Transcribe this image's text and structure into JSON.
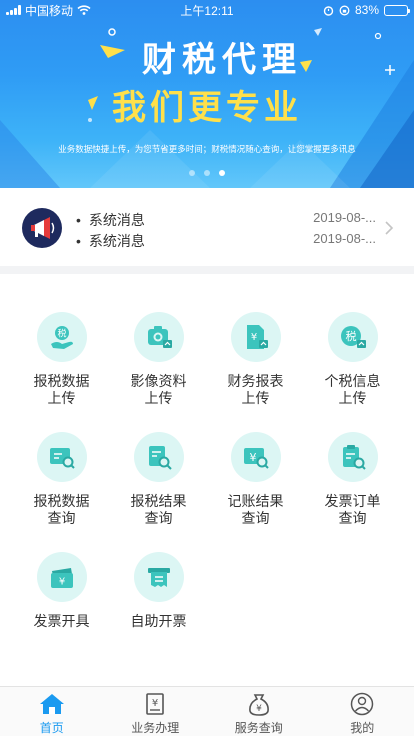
{
  "status_bar": {
    "carrier": "中国移动",
    "time": "上午12:11",
    "battery": "83%",
    "battery_level": 0.83
  },
  "banner": {
    "title_line1": "财税代理",
    "title_line2": "我们更专业",
    "subtitle": "业务数据快捷上传，为您节省更多时间；财税情况随心查询，让您掌握更多讯息",
    "page_count": 3,
    "active_page": 3
  },
  "notice": {
    "items": [
      {
        "text": "系统消息",
        "date": "2019-08-..."
      },
      {
        "text": "系统消息",
        "date": "2019-08-..."
      }
    ]
  },
  "services": [
    {
      "label": "报税数据\n上传",
      "icon": "tax-upload-icon"
    },
    {
      "label": "影像资料\n上传",
      "icon": "camera-upload-icon"
    },
    {
      "label": "财务报表\n上传",
      "icon": "report-upload-icon"
    },
    {
      "label": "个税信息\n上传",
      "icon": "personal-tax-upload-icon"
    },
    {
      "label": "报税数据\n查询",
      "icon": "tax-query-icon"
    },
    {
      "label": "报税结果\n查询",
      "icon": "tax-result-query-icon"
    },
    {
      "label": "记账结果\n查询",
      "icon": "bookkeeping-query-icon"
    },
    {
      "label": "发票订单\n查询",
      "icon": "invoice-order-query-icon"
    },
    {
      "label": "发票开具",
      "icon": "invoice-issue-icon"
    },
    {
      "label": "自助开票",
      "icon": "self-invoice-icon"
    }
  ],
  "tabbar": {
    "tabs": [
      {
        "label": "首页",
        "icon": "home-icon",
        "active": true
      },
      {
        "label": "业务办理",
        "icon": "yuan-receipt-icon",
        "active": false
      },
      {
        "label": "服务查询",
        "icon": "money-bag-icon",
        "active": false
      },
      {
        "label": "我的",
        "icon": "user-icon",
        "active": false
      }
    ]
  },
  "colors": {
    "accent": "#1a9af0",
    "teal": "#3cc4bd",
    "teal_bg": "#dcf6f4",
    "banner_yellow": "#ffe04a"
  }
}
